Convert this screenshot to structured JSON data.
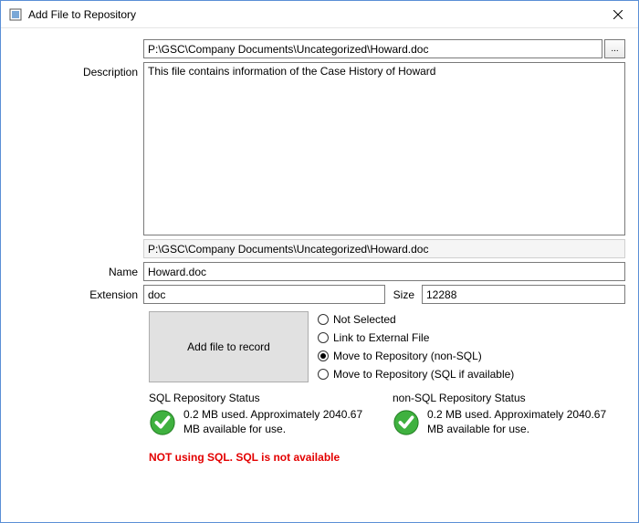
{
  "window": {
    "title": "Add File to Repository"
  },
  "path": {
    "value": "P:\\GSC\\Company Documents\\Uncategorized\\Howard.doc"
  },
  "browse": {
    "label": "..."
  },
  "labels": {
    "description": "Description",
    "name": "Name",
    "extension": "Extension",
    "size": "Size"
  },
  "description": {
    "value": "This file contains information of the Case History of Howard"
  },
  "readonly_path": "P:\\GSC\\Company Documents\\Uncategorized\\Howard.doc",
  "name_value": "Howard.doc",
  "extension_value": "doc",
  "size_value": "12288",
  "add_button": {
    "label": "Add file to record"
  },
  "radios": {
    "options": [
      {
        "label": "Not Selected",
        "checked": false
      },
      {
        "label": "Link to External File",
        "checked": false
      },
      {
        "label": "Move to Repository (non-SQL)",
        "checked": true
      },
      {
        "label": "Move to Repository (SQL if available)",
        "checked": false
      }
    ]
  },
  "status": {
    "sql": {
      "title": "SQL Repository Status",
      "text": "0.2 MB used.  Approximately 2040.67 MB available for use."
    },
    "nonsql": {
      "title": "non-SQL Repository Status",
      "text": "0.2 MB used.  Approximately 2040.67 MB available for use."
    }
  },
  "sql_warning": "NOT using SQL.  SQL is not available"
}
